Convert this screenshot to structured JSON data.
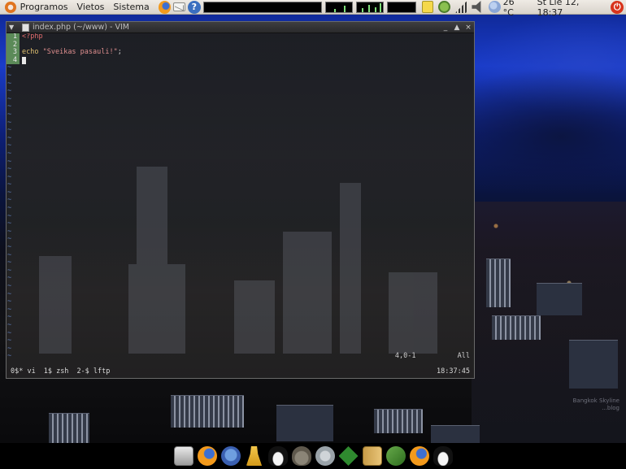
{
  "top_panel": {
    "menus": [
      "Programos",
      "Vietos",
      "Sistema"
    ],
    "launchers": [
      "firefox-icon",
      "mail-icon",
      "help-icon"
    ],
    "temperature": "26 °C",
    "clock": "Št Lie 12, 18:37",
    "power_icon_glyph": "⏻"
  },
  "vim_window": {
    "title": "index.php (~/www) - VIM",
    "buttons": [
      "_",
      "▲",
      "×"
    ],
    "lines": [
      {
        "num": "1",
        "parts": [
          {
            "cls": "kw-php",
            "text": "<?php"
          }
        ]
      },
      {
        "num": "2",
        "parts": []
      },
      {
        "num": "3",
        "parts": [
          {
            "cls": "kw-echo",
            "text": "echo"
          },
          {
            "cls": "",
            "text": " "
          },
          {
            "cls": "str",
            "text": "\"Sveikas pasauli!\""
          },
          {
            "cls": "",
            "text": ";"
          }
        ]
      },
      {
        "num": "4",
        "parts": [],
        "cursor": true
      }
    ],
    "tilde_count": 38,
    "ruler_position": "4,0-1",
    "ruler_scroll": "All",
    "screen_windows": [
      "0$* vi",
      "1$ zsh",
      "2-$ lftp"
    ],
    "screen_time": "18:37:45"
  },
  "dock": {
    "icons": [
      "media-icon",
      "firefox-icon",
      "pidgin-icon",
      "pawn-icon",
      "tux-icon",
      "gimp-icon",
      "disk-icon",
      "vim-icon",
      "archive-icon",
      "tools-icon",
      "firefox-icon",
      "tux-icon"
    ]
  },
  "wallpaper": {
    "watermark": [
      "Bangkok Skyline",
      "...blog"
    ]
  }
}
